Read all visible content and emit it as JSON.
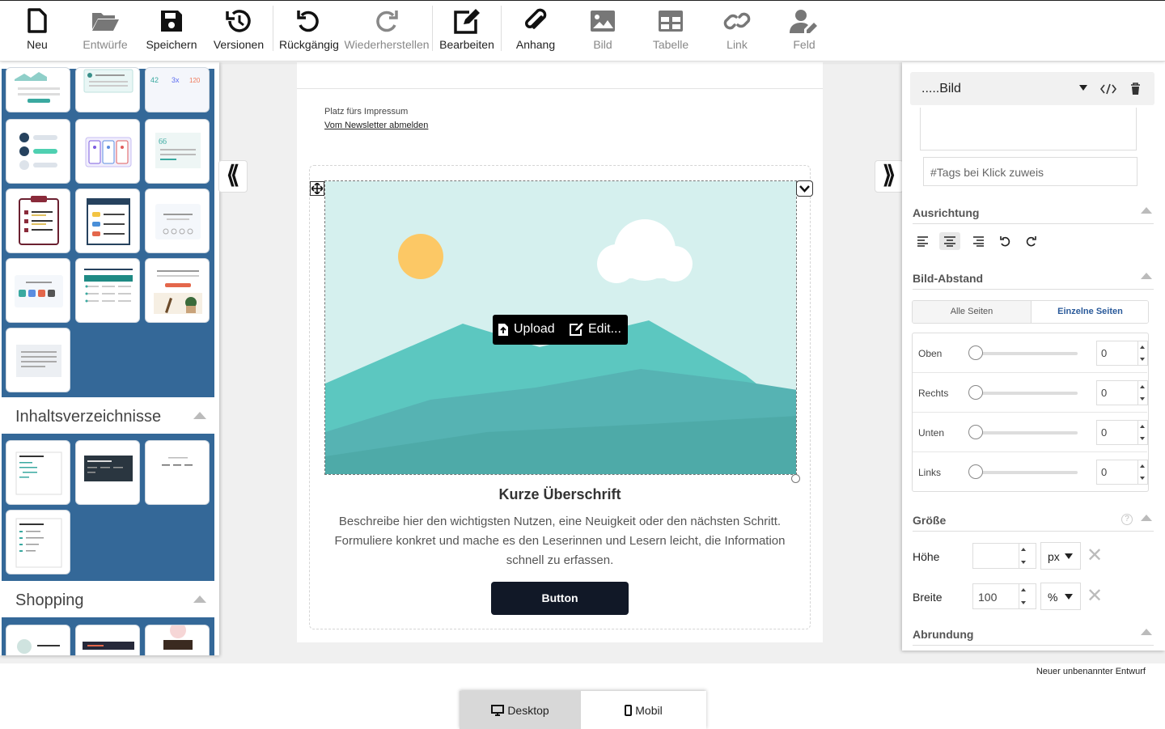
{
  "toolbar": {
    "items": [
      {
        "label": "Neu",
        "icon": "new-document-icon"
      },
      {
        "label": "Entwürfe",
        "icon": "folder-open-icon"
      },
      {
        "label": "Speichern",
        "icon": "floppy-disk-icon"
      },
      {
        "label": "Versionen",
        "icon": "history-icon"
      },
      {
        "label": "Rückgängig",
        "icon": "undo-icon"
      },
      {
        "label": "Wiederherstellen",
        "icon": "redo-icon"
      },
      {
        "label": "Bearbeiten",
        "icon": "edit-icon"
      },
      {
        "label": "Anhang",
        "icon": "paperclip-icon"
      },
      {
        "label": "Bild",
        "icon": "image-icon"
      },
      {
        "label": "Tabelle",
        "icon": "table-icon"
      },
      {
        "label": "Link",
        "icon": "link-icon"
      },
      {
        "label": "Feld",
        "icon": "user-field-icon"
      }
    ]
  },
  "left_panel": {
    "sections": [
      {
        "title": "Inhaltsverzeichnisse"
      },
      {
        "title": "Shopping"
      }
    ]
  },
  "canvas": {
    "imprint_text": "Platz fürs Impressum",
    "unsubscribe_link": "Vom Newsletter abmelden",
    "upload_button": "Upload",
    "edit_button": "Edit...",
    "heading": "Kurze Überschrift",
    "body_text": "Beschreibe hier den wichtigsten Nutzen, eine Neuigkeit oder den nächsten Schritt. Formuliere konkret und mache es den Leserinnen und Lesern leicht, die Information schnell zu erfassen.",
    "cta_button": "Button",
    "colors": {
      "sky": "#d5f0ee",
      "sun": "#fcc865",
      "hill_back": "#5cc7c0",
      "hill_front": "#56b3b3",
      "cta": "#111827"
    }
  },
  "collapse_left": "⟪",
  "expand_right": "⟫",
  "right_panel": {
    "element_name": ".....Bild",
    "tags_placeholder": "#Tags bei Klick zuweis",
    "sections": {
      "alignment": "Ausrichtung",
      "spacing": "Bild-Abstand",
      "size": "Größe",
      "rounding": "Abrundung"
    },
    "spacing_tabs": {
      "all": "Alle Seiten",
      "individual": "Einzelne Seiten"
    },
    "spacing_rows": [
      {
        "label": "Oben",
        "value": "0"
      },
      {
        "label": "Rechts",
        "value": "0"
      },
      {
        "label": "Unten",
        "value": "0"
      },
      {
        "label": "Links",
        "value": "0"
      }
    ],
    "height": {
      "label": "Höhe",
      "value": "",
      "unit": "px"
    },
    "width": {
      "label": "Breite",
      "value": "100",
      "unit": "%"
    }
  },
  "status": {
    "draft_name": "Neuer unbenannter Entwurf"
  },
  "device_tabs": {
    "desktop": "Desktop",
    "mobile": "Mobil"
  }
}
